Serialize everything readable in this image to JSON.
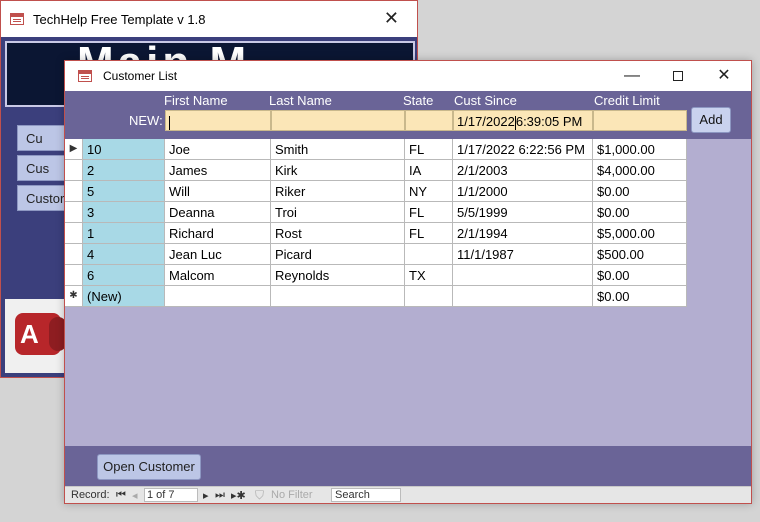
{
  "background_window": {
    "title": "TechHelp Free Template v 1.8",
    "header_text": "Main M",
    "buttons": [
      "Cu",
      "Cus",
      "Custor"
    ],
    "logo_letter": "A"
  },
  "window": {
    "title": "Customer List"
  },
  "columns": {
    "first_name": "First Name",
    "last_name": "Last Name",
    "state": "State",
    "cust_since": "Cust Since",
    "credit_limit": "Credit Limit"
  },
  "new_row": {
    "label": "NEW:",
    "first_name": "",
    "last_name": "",
    "state": "",
    "cust_since_before": "1/17/2022",
    "cust_since_after": "6:39:05 PM",
    "credit_limit": "",
    "add_label": "Add"
  },
  "rows": [
    {
      "id": "10",
      "first": "Joe",
      "last": "Smith",
      "state": "FL",
      "since": "1/17/2022 6:22:56 PM",
      "credit": "$1,000.00",
      "selector": "▶"
    },
    {
      "id": "2",
      "first": "James",
      "last": "Kirk",
      "state": "IA",
      "since": "2/1/2003",
      "credit": "$4,000.00",
      "selector": ""
    },
    {
      "id": "5",
      "first": "Will",
      "last": "Riker",
      "state": "NY",
      "since": "1/1/2000",
      "credit": "$0.00",
      "selector": ""
    },
    {
      "id": "3",
      "first": "Deanna",
      "last": "Troi",
      "state": "FL",
      "since": "5/5/1999",
      "credit": "$0.00",
      "selector": ""
    },
    {
      "id": "1",
      "first": "Richard",
      "last": "Rost",
      "state": "FL",
      "since": "2/1/1994",
      "credit": "$5,000.00",
      "selector": ""
    },
    {
      "id": "4",
      "first": "Jean Luc",
      "last": "Picard",
      "state": "",
      "since": "11/1/1987",
      "credit": "$500.00",
      "selector": ""
    },
    {
      "id": "6",
      "first": "Malcom",
      "last": "Reynolds",
      "state": "TX",
      "since": "",
      "credit": "$0.00",
      "selector": ""
    },
    {
      "id": "(New)",
      "first": "",
      "last": "",
      "state": "",
      "since": "",
      "credit": "$0.00",
      "selector": "✱"
    }
  ],
  "footer": {
    "open_label": "Open Customer"
  },
  "navigation": {
    "record_label": "Record:",
    "first": "⏮",
    "prev": "◂",
    "position": "1 of 7",
    "next": "▸",
    "last": "⏭",
    "new": "▸✱",
    "filter_icon": "⛉",
    "filter_label": "No Filter",
    "search_label": "Search"
  }
}
